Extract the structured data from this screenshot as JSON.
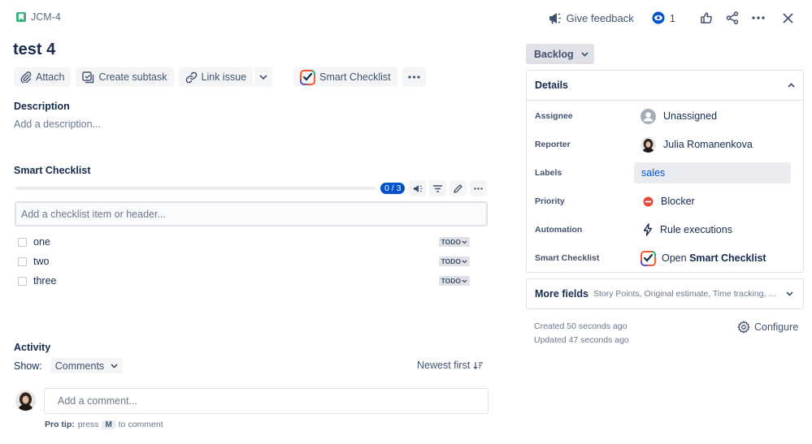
{
  "header": {
    "issue_key": "JCM-4",
    "feedback_label": "Give feedback",
    "watch_count": "1"
  },
  "issue": {
    "title": "test 4"
  },
  "actions": {
    "attach": "Attach",
    "create_subtask": "Create subtask",
    "link_issue": "Link issue",
    "smart_checklist": "Smart Checklist"
  },
  "description": {
    "heading": "Description",
    "placeholder": "Add a description..."
  },
  "checklist": {
    "heading": "Smart Checklist",
    "progress_text": "0 / 3",
    "progress_fraction": 0,
    "input_placeholder": "Add a checklist item or header...",
    "items": [
      {
        "text": "one",
        "status": "TODO"
      },
      {
        "text": "two",
        "status": "TODO"
      },
      {
        "text": "three",
        "status": "TODO"
      }
    ]
  },
  "activity": {
    "heading": "Activity",
    "show_label": "Show:",
    "show_value": "Comments",
    "sort_label": "Newest first",
    "comment_placeholder": "Add a comment...",
    "pro_tip_label": "Pro tip:",
    "pro_tip_press": "press",
    "pro_tip_key": "M",
    "pro_tip_suffix": "to comment"
  },
  "sidebar": {
    "status": "Backlog",
    "details_heading": "Details",
    "fields": [
      {
        "label": "Assignee",
        "value": "Unassigned"
      },
      {
        "label": "Reporter",
        "value": "Julia Romanenkova"
      },
      {
        "label": "Labels",
        "value": "sales"
      },
      {
        "label": "Priority",
        "value": "Blocker"
      },
      {
        "label": "Automation",
        "value": "Rule executions"
      },
      {
        "label": "Smart Checklist",
        "value_prefix": "Open",
        "value_bold": "Smart Checklist"
      }
    ],
    "more_fields_heading": "More fields",
    "more_fields_sub": "Story Points, Original estimate, Time tracking, Epic Link",
    "created": "Created 50 seconds ago",
    "updated": "Updated 47 seconds ago",
    "configure": "Configure"
  },
  "colors": {
    "brand_blue": "#0052cc",
    "priority_red": "#e5493a",
    "story_green": "#36b37e"
  }
}
